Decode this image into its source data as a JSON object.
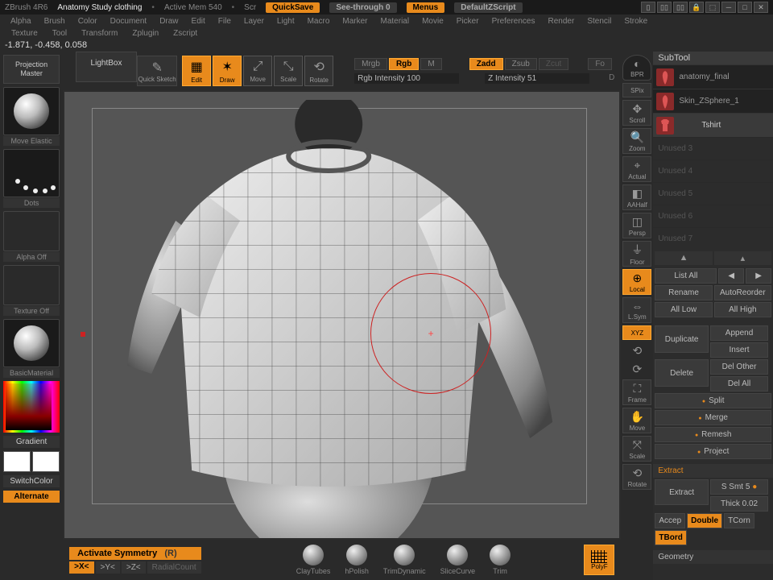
{
  "titlebar": {
    "app": "ZBrush 4R6",
    "scene": "Anatomy Study clothing",
    "mem": "Active Mem 540",
    "scr": "Scr",
    "quicksave": "QuickSave",
    "seethrough": "See-through  0",
    "menus": "Menus",
    "zscript": "DefaultZScript"
  },
  "menus1": [
    "Alpha",
    "Brush",
    "Color",
    "Document",
    "Draw",
    "Edit",
    "File",
    "Layer",
    "Light",
    "Macro",
    "Marker",
    "Material",
    "Movie",
    "Picker",
    "Preferences",
    "Render",
    "Stencil",
    "Stroke"
  ],
  "menus2": [
    "Texture",
    "Tool",
    "Transform",
    "Zplugin",
    "Zscript"
  ],
  "coords": "-1.871, -0.458, 0.058",
  "left": {
    "projection_master": "Projection Master",
    "lightbox": "LightBox",
    "move_elastic": "Move Elastic",
    "dots": "Dots",
    "alpha_off": "Alpha Off",
    "texture_off": "Texture Off",
    "basic_material": "BasicMaterial",
    "gradient": "Gradient",
    "switchcolor": "SwitchColor",
    "alternate": "Alternate"
  },
  "toolbar": {
    "quick_sketch": "Quick Sketch",
    "edit": "Edit",
    "draw": "Draw",
    "move": "Move",
    "scale": "Scale",
    "rotate": "Rotate",
    "mrgb": "Mrgb",
    "rgb": "Rgb",
    "m": "M",
    "zadd": "Zadd",
    "zsub": "Zsub",
    "zcut": "Zcut",
    "fo": "Fo",
    "rgb_intensity": "Rgb Intensity 100",
    "z_intensity": "Z Intensity 51",
    "d": "D"
  },
  "rnav": {
    "bpr": "BPR",
    "spix": "SPix",
    "scroll": "Scroll",
    "zoom": "Zoom",
    "actual": "Actual",
    "aahalf": "AAHalf",
    "persp": "Persp",
    "floor": "Floor",
    "local": "Local",
    "lsym": "L.Sym",
    "xyz": "XYZ",
    "frame": "Frame",
    "move": "Move",
    "scale": "Scale",
    "rotate": "Rotate"
  },
  "bottom": {
    "activate_symmetry": "Activate Symmetry",
    "r": "(R)",
    "sym_x": ">X<",
    "sym_y": ">Y<",
    "sym_z": ">Z<",
    "radial": "RadialCount",
    "brushes": [
      "ClayTubes",
      "hPolish",
      "TrimDynamic",
      "SliceCurve",
      "Trim"
    ],
    "polyf": "PolyF"
  },
  "right": {
    "subtool": "SubTool",
    "items": [
      {
        "name": "anatomy_final"
      },
      {
        "name": "Skin_ZSphere_1"
      },
      {
        "name": "Tshirt"
      }
    ],
    "unused": [
      "Unused 3",
      "Unused 4",
      "Unused 5",
      "Unused 6",
      "Unused 7"
    ],
    "list_all": "List All",
    "rename": "Rename",
    "autoreorder": "AutoReorder",
    "all_low": "All Low",
    "all_high": "All High",
    "duplicate": "Duplicate",
    "append": "Append",
    "insert": "Insert",
    "delete": "Delete",
    "del_other": "Del Other",
    "del_all": "Del All",
    "split": "Split",
    "merge": "Merge",
    "remesh": "Remesh",
    "project": "Project",
    "extract_section": "Extract",
    "extract": "Extract",
    "s_smt": "S Smt 5",
    "thick": "Thick 0.02",
    "accep": "Accep",
    "double": "Double",
    "tcorn": "TCorn",
    "tbord": "TBord",
    "geometry": "Geometry"
  }
}
